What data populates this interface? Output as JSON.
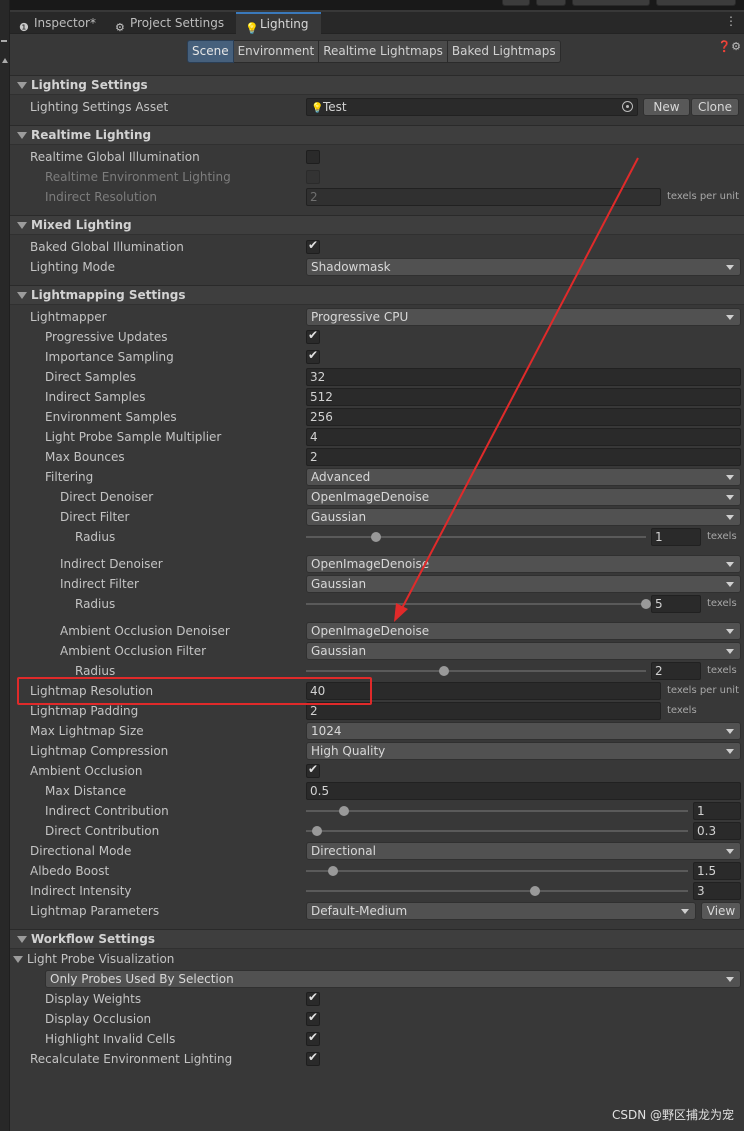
{
  "tabs": [
    {
      "label": "Inspector*",
      "icon": "info-icon"
    },
    {
      "label": "Project Settings",
      "icon": "gear-icon"
    },
    {
      "label": "Lighting",
      "icon": "bulb-icon"
    }
  ],
  "tab_menu": "⋮",
  "segments": [
    "Scene",
    "Environment",
    "Realtime Lightmaps",
    "Baked Lightmaps"
  ],
  "active_segment": "Scene",
  "sections": {
    "lighting_settings": "Lighting Settings",
    "realtime_lighting": "Realtime Lighting",
    "mixed_lighting": "Mixed Lighting",
    "lightmapping_settings": "Lightmapping Settings",
    "workflow_settings": "Workflow Settings"
  },
  "lighting_settings": {
    "asset_label": "Lighting Settings Asset",
    "asset_value": "Test",
    "new_button": "New",
    "clone_button": "Clone"
  },
  "realtime": {
    "rgi_label": "Realtime Global Illumination",
    "rel_label": "Realtime Environment Lighting",
    "indirect_res_label": "Indirect Resolution",
    "indirect_res_value": "2",
    "indirect_res_unit": "texels per unit"
  },
  "mixed": {
    "bgi_label": "Baked Global Illumination",
    "mode_label": "Lighting Mode",
    "mode_value": "Shadowmask"
  },
  "lightmapping": {
    "lightmapper_label": "Lightmapper",
    "lightmapper_value": "Progressive CPU",
    "progressive_updates": "Progressive Updates",
    "importance_sampling": "Importance Sampling",
    "direct_samples_label": "Direct Samples",
    "direct_samples_value": "32",
    "indirect_samples_label": "Indirect Samples",
    "indirect_samples_value": "512",
    "env_samples_label": "Environment Samples",
    "env_samples_value": "256",
    "lpsm_label": "Light Probe Sample Multiplier",
    "lpsm_value": "4",
    "max_bounces_label": "Max Bounces",
    "max_bounces_value": "2",
    "filtering_label": "Filtering",
    "filtering_value": "Advanced",
    "direct_denoiser_label": "Direct Denoiser",
    "direct_denoiser_value": "OpenImageDenoise",
    "direct_filter_label": "Direct Filter",
    "direct_filter_value": "Gaussian",
    "radius_label": "Radius",
    "direct_radius_value": "1",
    "direct_radius_fraction": 0.207,
    "texels": "texels",
    "indirect_denoiser_label": "Indirect Denoiser",
    "indirect_denoiser_value": "OpenImageDenoise",
    "indirect_filter_label": "Indirect Filter",
    "indirect_filter_value": "Gaussian",
    "indirect_radius_value": "5",
    "indirect_radius_fraction": 1.0,
    "ao_denoiser_label": "Ambient Occlusion Denoiser",
    "ao_denoiser_value": "OpenImageDenoise",
    "ao_filter_label": "Ambient Occlusion Filter",
    "ao_filter_value": "Gaussian",
    "ao_radius_value": "2",
    "ao_radius_fraction": 0.405,
    "lm_res_label": "Lightmap Resolution",
    "lm_res_value": "40",
    "lm_res_unit": "texels per unit",
    "lm_padding_label": "Lightmap Padding",
    "lm_padding_value": "2",
    "lm_padding_unit": "texels",
    "max_lm_size_label": "Max Lightmap Size",
    "max_lm_size_value": "1024",
    "lm_compression_label": "Lightmap Compression",
    "lm_compression_value": "High Quality",
    "ao_label": "Ambient Occlusion",
    "max_distance_label": "Max Distance",
    "max_distance_value": "0.5",
    "indirect_contribution_label": "Indirect Contribution",
    "indirect_contribution_value": "1",
    "indirect_contribution_fraction": 0.1,
    "direct_contribution_label": "Direct Contribution",
    "direct_contribution_value": "0.3",
    "direct_contribution_fraction": 0.03,
    "directional_mode_label": "Directional Mode",
    "directional_mode_value": "Directional",
    "albedo_boost_label": "Albedo Boost",
    "albedo_boost_value": "1.5",
    "albedo_boost_fraction": 0.07,
    "indirect_intensity_label": "Indirect Intensity",
    "indirect_intensity_value": "3",
    "indirect_intensity_fraction": 0.6,
    "lm_params_label": "Lightmap Parameters",
    "lm_params_value": "Default-Medium",
    "view_button": "View"
  },
  "workflow": {
    "lpv_label": "Light Probe Visualization",
    "lpv_value": "Only Probes Used By Selection",
    "display_weights": "Display Weights",
    "display_occlusion": "Display Occlusion",
    "highlight_invalid": "Highlight Invalid Cells",
    "recalc_env": "Recalculate Environment Lighting"
  },
  "watermark": "CSDN @野区捕龙为宠",
  "colors": {
    "background": "#383838",
    "accent": "#3a79bb",
    "annotation_red": "#e02a2a"
  }
}
